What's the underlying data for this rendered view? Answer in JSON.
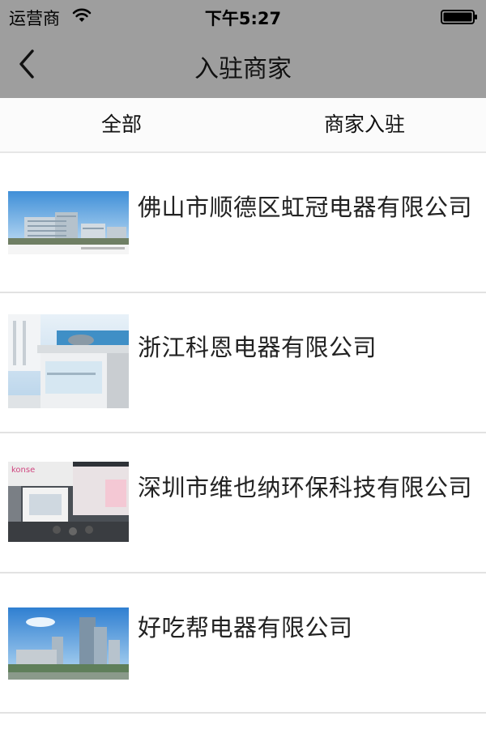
{
  "status_bar": {
    "carrier": "运营商",
    "time": "下午5:27",
    "wifi_icon": "wifi-icon",
    "battery_icon": "battery-icon"
  },
  "nav": {
    "title": "入驻商家",
    "back_icon": "chevron-left-icon"
  },
  "tabs": [
    {
      "label": "全部"
    },
    {
      "label": "商家入驻"
    }
  ],
  "companies": [
    {
      "name": "佛山市顺德区虹冠电器有限公司",
      "thumbnail": "factory-buildings-image"
    },
    {
      "name": "浙江科恩电器有限公司",
      "thumbnail": "kitchen-appliance-image"
    },
    {
      "name": "深圳市维也纳环保科技有限公司",
      "thumbnail": "exhibition-booth-image"
    },
    {
      "name": "好吃帮电器有限公司",
      "thumbnail": "city-towers-image"
    }
  ],
  "colors": {
    "header_bg": "#9e9e9e",
    "tab_bg": "#fbfbfb",
    "divider": "#e2e2e2",
    "text": "#222222"
  }
}
